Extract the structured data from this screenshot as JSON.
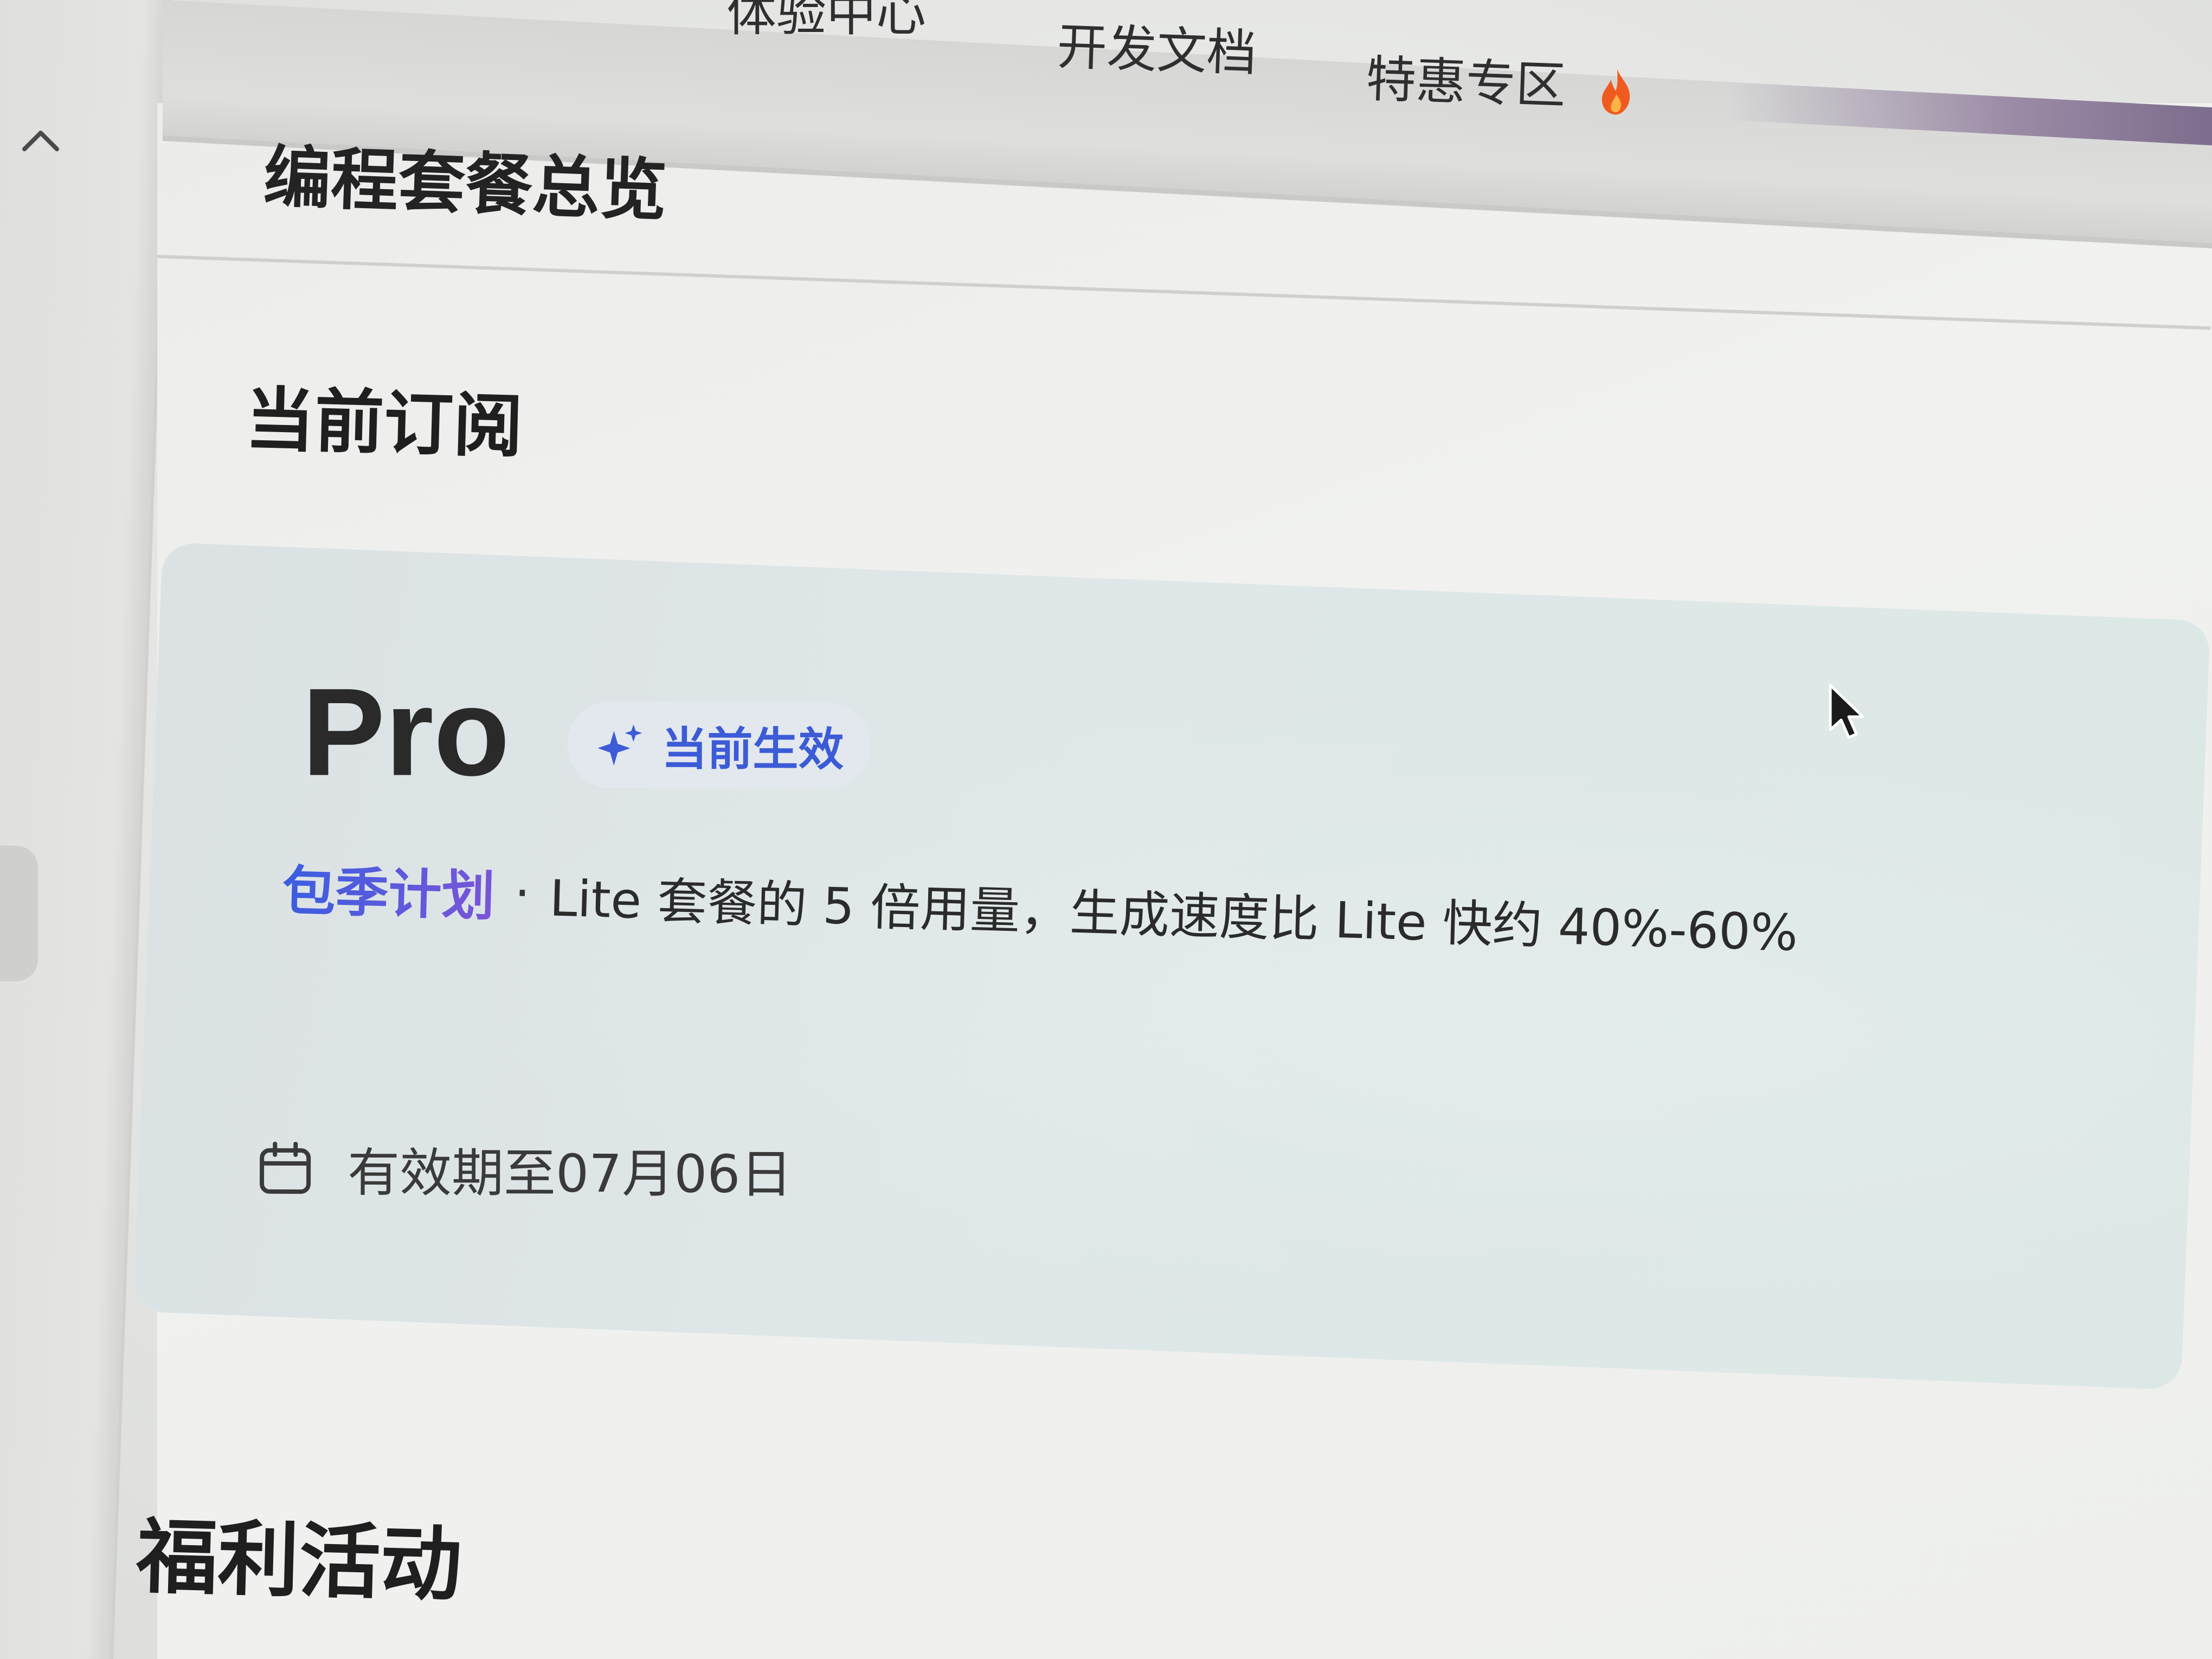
{
  "nav": {
    "experience_center": "体验中心",
    "dev_docs": "开发文档",
    "special_deals": "特惠专区",
    "special_deals_icon": "flame-icon"
  },
  "page": {
    "title": "编程套餐总览"
  },
  "current_subscription": {
    "section_title": "当前订阅",
    "plan_name": "Pro",
    "status": "当前生效",
    "status_icon": "sparkle-icon",
    "billing_period": "包季计划",
    "separator": "·",
    "description": "Lite 套餐的 5 倍用量，生成速度比 Lite 快约 40%-60%",
    "expiry_icon": "calendar-icon",
    "expiry": "有效期至07月06日"
  },
  "benefits": {
    "section_title": "福利活动"
  },
  "colors": {
    "accent_blue": "#3c5bd6",
    "accent_purple": "#7a55d8",
    "flame_orange": "#f05a1e"
  }
}
